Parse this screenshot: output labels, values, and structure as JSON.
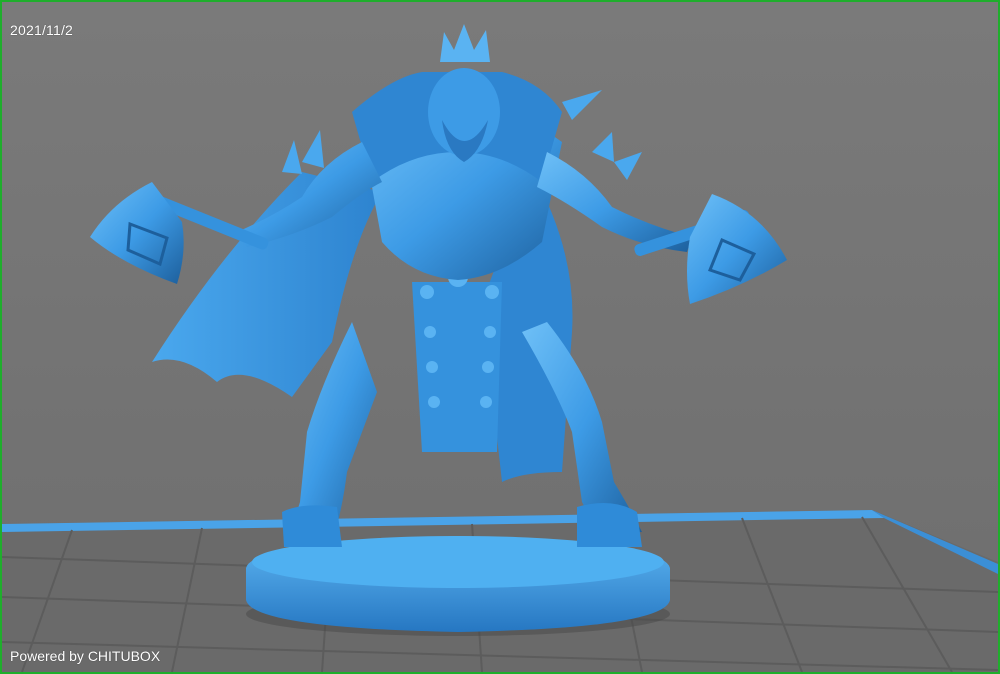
{
  "viewer": {
    "date": "2021/11/2",
    "watermark": "Powered by CHITUBOX"
  },
  "colors": {
    "frame": "#1fae2c",
    "background": "#737373",
    "model": "#3d9be6",
    "model_shadow": "#1f5f9a",
    "build_plate_edge": "#4aa3e8",
    "grid": "#5e5e5e"
  },
  "icons": {
    "model": "miniature-warrior-figure",
    "build_plate": "build-plate-grid"
  }
}
